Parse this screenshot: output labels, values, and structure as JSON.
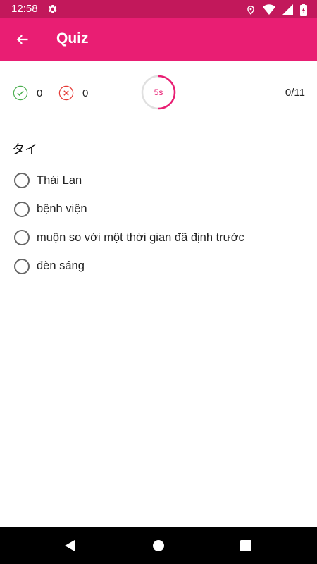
{
  "status_bar": {
    "time": "12:58",
    "icons": [
      "gear-icon",
      "location-icon",
      "wifi-icon",
      "signal-icon",
      "battery-icon"
    ]
  },
  "app_bar": {
    "title": "Quiz",
    "back_icon": "arrow-back-icon",
    "color": "#e91e73",
    "status_color": "#c2185b"
  },
  "score": {
    "correct": "0",
    "wrong": "0",
    "correct_color": "#4caf50",
    "wrong_color": "#e53935"
  },
  "timer": {
    "label": "5s",
    "fraction_remaining": 0.5
  },
  "progress": "0/11",
  "question": "タイ",
  "options": [
    {
      "label": "Thái Lan"
    },
    {
      "label": "bệnh viện"
    },
    {
      "label": "muộn so với một thời gian đã định trước"
    },
    {
      "label": "đèn sáng"
    }
  ],
  "nav_bar": {
    "icons": [
      "back-triangle-icon",
      "home-circle-icon",
      "recents-square-icon"
    ]
  }
}
